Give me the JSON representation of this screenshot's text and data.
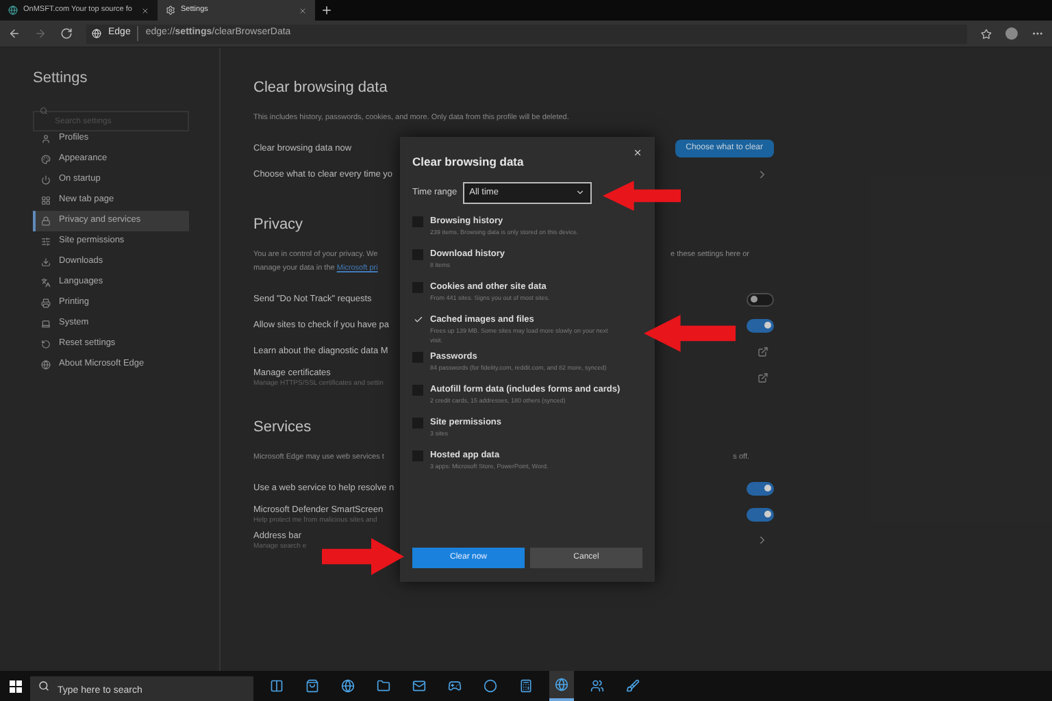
{
  "browser": {
    "tabs": [
      {
        "title": "OnMSFT.com Your top source fo",
        "selected": false
      },
      {
        "title": "Settings",
        "selected": true
      }
    ],
    "site_label": "Edge",
    "url": "edge://**settings**/clearBrowserData"
  },
  "sidebar": {
    "title": "Settings",
    "search_placeholder": "Search settings",
    "items": [
      {
        "label": "Profiles",
        "selected": false
      },
      {
        "label": "Appearance",
        "selected": false
      },
      {
        "label": "On startup",
        "selected": false
      },
      {
        "label": "New tab page",
        "selected": false
      },
      {
        "label": "Privacy and services",
        "selected": true
      },
      {
        "label": "Site permissions",
        "selected": false
      },
      {
        "label": "Downloads",
        "selected": false
      },
      {
        "label": "Languages",
        "selected": false
      },
      {
        "label": "Printing",
        "selected": false
      },
      {
        "label": "System",
        "selected": false
      },
      {
        "label": "Reset settings",
        "selected": false
      },
      {
        "label": "About Microsoft Edge",
        "selected": false
      }
    ]
  },
  "content": {
    "items": [
      {
        "kind": "heading",
        "text": "Clear browsing data"
      },
      {
        "kind": "description",
        "lines": [
          "This includes history, passwords, cookies, and more. Only data from this profile will be deleted."
        ]
      },
      {
        "kind": "setting",
        "label": "Clear browsing data now",
        "control": {
          "kind": "button",
          "label": "Choose what to clear"
        }
      },
      {
        "kind": "setting",
        "label": "Choose what to clear every time yo",
        "control": {
          "kind": "chevron"
        }
      },
      {
        "kind": "heading",
        "text": "Privacy"
      },
      {
        "kind": "description",
        "lines": [
          "You are in control of your privacy. We",
          "manage your data in the"
        ],
        "link": "Microsoft pri",
        "trailing": "e these settings here or"
      },
      {
        "kind": "setting",
        "label": "Send \"Do Not Track\" requests",
        "control": {
          "kind": "toggle",
          "on": false
        }
      },
      {
        "kind": "setting",
        "label": "Allow sites to check if you have pa",
        "control": {
          "kind": "toggle",
          "on": true
        }
      },
      {
        "kind": "setting",
        "label": "Learn about the diagnostic data M",
        "control": {
          "kind": "external"
        }
      },
      {
        "kind": "setting",
        "label": "Manage certificates",
        "detail": "Manage HTTPS/SSL certificates and settin",
        "control": {
          "kind": "external"
        }
      },
      {
        "kind": "heading",
        "text": "Services"
      },
      {
        "kind": "description",
        "lines": [
          "Microsoft Edge may use web services t"
        ],
        "trailing": "s off."
      },
      {
        "kind": "setting",
        "label": "Use a web service to help resolve n",
        "control": {
          "kind": "toggle",
          "on": true
        }
      },
      {
        "kind": "setting",
        "label": "Microsoft Defender SmartScreen",
        "detail": "Help protect me from malicious sites and",
        "control": {
          "kind": "toggle",
          "on": true
        }
      },
      {
        "kind": "setting",
        "label": "Address bar",
        "detail": "Manage search e",
        "control": {
          "kind": "chevron"
        }
      }
    ]
  },
  "dialog": {
    "title": "Clear browsing data",
    "time_range_label": "Time range",
    "time_range_value": "All time",
    "options": [
      {
        "label": "Browsing history",
        "detail": "239 items. Browsing data is only stored on this device.",
        "checked": false
      },
      {
        "label": "Download history",
        "detail": "8 items",
        "checked": false
      },
      {
        "label": "Cookies and other site data",
        "detail": "From 441 sites. Signs you out of most sites.",
        "checked": false
      },
      {
        "label": "Cached images and files",
        "detail": "Frees up 139 MB. Some sites may load more slowly on your next visit.",
        "checked": true
      },
      {
        "label": "Passwords",
        "detail": "84 passwords (for fidelity.com, reddit.com, and 82 more, synced)",
        "checked": false
      },
      {
        "label": "Autofill form data (includes forms and cards)",
        "detail": "2 credit cards, 15 addresses, 180 others (synced)",
        "checked": false
      },
      {
        "label": "Site permissions",
        "detail": "3 sites",
        "checked": false
      },
      {
        "label": "Hosted app data",
        "detail": "3 apps: Microsoft Store, PowerPoint, Word.",
        "checked": false
      }
    ],
    "primary_button": "Clear now",
    "secondary_button": "Cancel"
  },
  "taskbar": {
    "search_placeholder": "Type here to search"
  }
}
